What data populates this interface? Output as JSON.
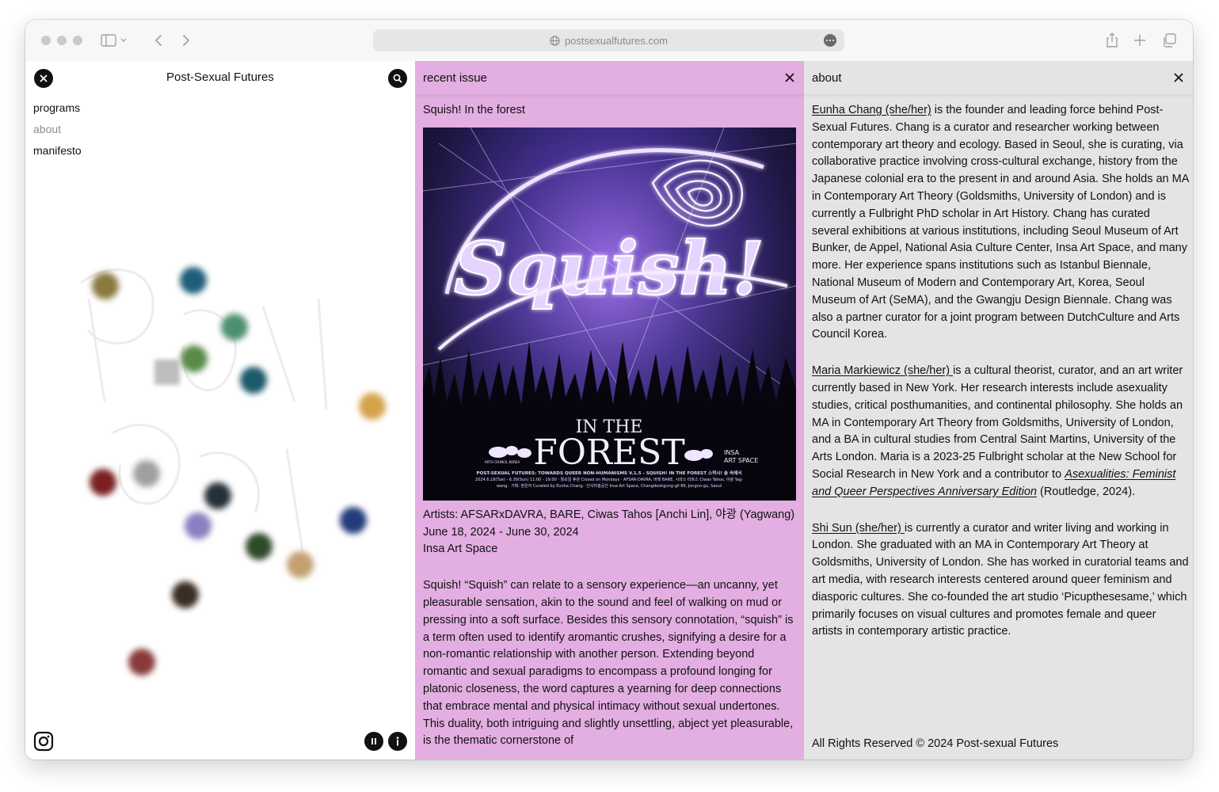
{
  "browser": {
    "url": "postsexualfutures.com"
  },
  "site": {
    "title": "Post-Sexual Futures",
    "nav": [
      {
        "label": "programs",
        "state": "default"
      },
      {
        "label": "about",
        "state": "muted"
      },
      {
        "label": "manifesto",
        "state": "default"
      }
    ]
  },
  "recent_issue": {
    "panel_title": "recent issue",
    "heading": "Squish! In the forest",
    "poster": {
      "big_word": "Squish!",
      "subtitle_small": "IN THE",
      "subtitle_big": "FOREST",
      "logo_left": "ARTS COUNCIL KOREA",
      "logo_right_1": "INSA",
      "logo_right_2": "ART SPACE",
      "small_line_1": "POST-SEXUAL FUTURES: TOWARDS QUEER NON-HUMANISMS V.1.5 - SQUISH! IN THE FOREST 스퀴시! 숲 속에서",
      "small_line_2": "2024.6.18(Tue) - 6.30(Sun) 11:00 - 19:00 · 월요일 휴관 Closed on Mondays · AFSAR-DAVRA, 바레 BARE, 시와스 타호스 Ciwas Tahos, 야광 Yag-",
      "small_line_3": "wang · 기획: 장은하 Curated by Eunha Chang · 인사미술공간 Insa Art Space, Changdeokgung-gil 89, Jongno-gu, Seoul"
    },
    "artists": "Artists: AFSARxDAVRA, BARE, Ciwas Tahos [Anchi Lin], 야광 (Yagwang)",
    "dates": "June 18, 2024 - June 30, 2024",
    "venue": "Insa Art Space",
    "description": "Squish! “Squish” can relate to a sensory experience—an uncanny, yet pleasurable sensation, akin to the sound and feel of walking on mud or pressing into a soft surface. Besides this sensory connotation, “squish” is a term often used to identify aromantic crushes, signifying a desire for a non-romantic relationship with another person. Extending beyond romantic and sexual paradigms to encompass a profound longing for platonic closeness, the word captures a yearning for deep connections that embrace mental and physical intimacy without sexual undertones. This duality, both intriguing and slightly unsettling, abject yet pleasurable, is the thematic cornerstone of"
  },
  "about": {
    "panel_title": "about",
    "bio1_name": "Eunha Chang (she/her)",
    "bio1_text": " is the founder and leading force behind Post-Sexual Futures. Chang is a curator and researcher working between contemporary art theory and ecology. Based in Seoul, she is curating, via collaborative practice involving cross-cultural exchange, history from the Japanese colonial era to the present in and around Asia. She holds an MA in Contemporary Art Theory (Goldsmiths, University of London) and is currently a Fulbright PhD scholar in Art History. Chang has curated several exhibitions at various institutions, including Seoul Museum of Art Bunker, de Appel, National Asia Culture Center, Insa Art Space, and many more. Her experience spans institutions such as Istanbul Biennale, National Museum of Modern and Contemporary Art, Korea, Seoul Museum of Art (SeMA), and the Gwangju Design Biennale. Chang was also a partner curator for a joint program between DutchCulture and Arts Council Korea.",
    "bio2_name": "Maria Markiewicz (she/her) ",
    "bio2_text": "is a cultural theorist, curator, and an art writer currently based in New York. Her research interests include asexuality studies, critical posthumanities, and continental philosophy. She holds an MA in Contemporary Art Theory from Goldsmiths, University of London, and a BA in cultural studies from Central Saint Martins, University of the Arts London. Maria is a 2023-25 Fulbright scholar at the New School for Social Research in New York and a contributor to ",
    "bio2_book": "Asexualities: Feminist and Queer Perspectives Anniversary Edition",
    "bio2_tail": " (Routledge, 2024).",
    "bio3_name": "Shi Sun (she/her) ",
    "bio3_text": "is currently a curator and writer living and working in London. She graduated with an MA in Contemporary Art Theory at Goldsmiths, University of London. She has worked in curatorial teams and art media, with research interests centered around queer feminism and diasporic cultures. She co-founded the art studio ‘Picupthesesame,’ which primarily focuses on visual cultures and promotes female and queer artists in contemporary artistic practice.",
    "footer": "All Rights Reserved © 2024 Post-sexual Futures"
  },
  "icons": [
    "close-icon",
    "search-icon",
    "instagram-icon",
    "pause-icon",
    "info-icon",
    "sidebar-icon",
    "back-icon",
    "forward-icon",
    "share-icon",
    "new-tab-icon",
    "tabs-overview-icon",
    "globe-icon"
  ],
  "colors": {
    "recent_issue_bg": "#e3aee1",
    "about_bg": "#e4e4e4",
    "poster_glow": "#c9a6ff"
  }
}
